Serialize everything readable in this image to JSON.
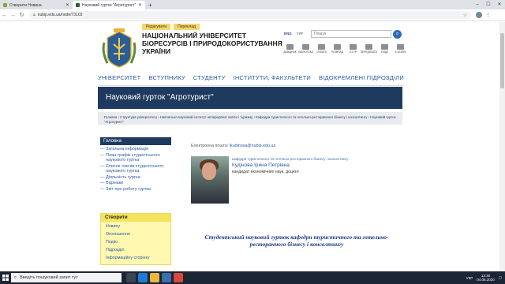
{
  "browser": {
    "tabs": [
      {
        "title": "Створити Новина",
        "fav_color": "#7cab3b"
      },
      {
        "title": "Науковий гурток \"Агротурист\"",
        "fav_color": "#2d5f2d"
      }
    ],
    "url": "nubip.edu.ua/node/73103",
    "new_tab": "+",
    "window_controls": [
      "–",
      "☐",
      "✕"
    ]
  },
  "header": {
    "top_links": [
      "Редагувати",
      "Переклад"
    ],
    "university_name": "НАЦІОНАЛЬНИЙ УНІВЕРСИТЕТ БІОРЕСУРСІВ І ПРИРОДОКОРИСТУВАННЯ УКРАЇНИ",
    "languages": [
      "ENG",
      "УКР"
    ],
    "search_placeholder": "Пошук",
    "quick_links": [
      "ДОВІДНИК",
      "БІБЛІОТЕКА",
      "ОПЛАТА",
      "РОЗКЛАД",
      "Е-ГУР",
      "ПЕРЕДПЛАТА",
      "ПОДІЇ",
      "E-LEARN"
    ]
  },
  "main_nav": [
    "УНІВЕРСИТЕТ",
    "ВСТУПНИКУ",
    "СТУДЕНТУ",
    "ІНСТИТУТИ, ФАКУЛЬТЕТИ",
    "ВІДОКРЕМЛЕНІ ПІДРОЗДІЛИ"
  ],
  "page_title": "Науковий гурток \"Агротурист\"",
  "breadcrumbs": "Головна › Структура університету › Навчально-науковий інститут неперервної освіти і туризму › Кафедра туристичного та готельно-ресторанного бізнесу і консалтингу › Науковий гурток \"Агротурист\"",
  "sidebar": {
    "heading": "Головна",
    "items": [
      "Загальна інформація",
      "План-графік студентського наукового гуртка",
      "Список членів студентського наукового гуртка",
      "Діяльність гуртка",
      "Відзнаки",
      "Звіт про роботу гуртка"
    ]
  },
  "create_box": {
    "heading": "Створити",
    "items": [
      "Новину",
      "Оголошення",
      "Подію",
      "Підрозділ",
      "Інформаційну сторінку"
    ]
  },
  "content": {
    "email_label": "Електронна пошта:",
    "email": "lkudinova@nubip.edu.ua",
    "department": "кафедра туристичного та готельно-ресторанного бізнесу і консалтингу",
    "person_name": "Кудінова Ірина Петрівна",
    "person_degree": "кандидат економічних наук, доцент",
    "subtitle": "Студентський науковий гурток кафедри туристичного та готельно-ресторанного бізнесу і консалтингу"
  },
  "taskbar": {
    "search_placeholder": "Введіть пошуковий запит тут",
    "lang": "УКР",
    "time": "13:30",
    "date": "04.06.2020"
  },
  "colors": {
    "title_bar": "#1f3a5f",
    "nav_text": "#2a5aa0",
    "create_box": "#fff8b0"
  }
}
